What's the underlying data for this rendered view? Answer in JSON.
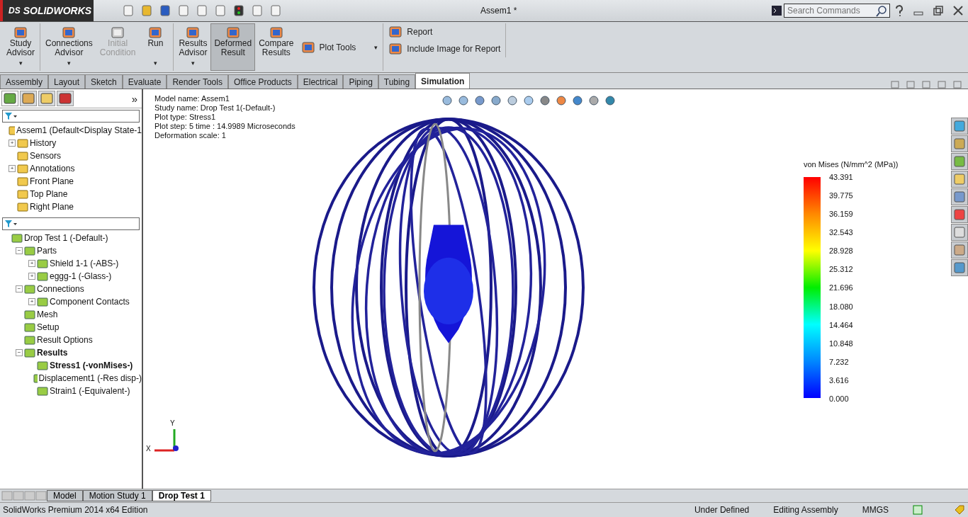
{
  "window": {
    "title": "Assem1 *",
    "logo_mark": "DS",
    "logo": "SOLIDWORKS"
  },
  "search": {
    "placeholder": "Search Commands"
  },
  "ribbon": {
    "groups": [
      {
        "buttons": [
          {
            "kind": "large",
            "lines": [
              "Study",
              "Advisor"
            ],
            "disabled": false,
            "selected": false,
            "caret": "▾"
          }
        ]
      },
      {
        "buttons": [
          {
            "kind": "large",
            "lines": [
              "Connections",
              "Advisor"
            ],
            "disabled": false,
            "selected": false,
            "caret": "▾"
          },
          {
            "kind": "large",
            "lines": [
              "Initial",
              "Condition"
            ],
            "disabled": true,
            "selected": false
          },
          {
            "kind": "large",
            "lines": [
              "Run"
            ],
            "disabled": false,
            "selected": false,
            "caret": "▾"
          }
        ]
      },
      {
        "buttons": [
          {
            "kind": "large",
            "lines": [
              "Results",
              "Advisor"
            ],
            "disabled": false,
            "selected": false,
            "caret": "▾"
          },
          {
            "kind": "large",
            "lines": [
              "Deformed",
              "Result"
            ],
            "disabled": false,
            "selected": true
          },
          {
            "kind": "large",
            "lines": [
              "Compare",
              "Results"
            ],
            "disabled": false,
            "selected": false
          },
          {
            "kind": "small",
            "lines": [
              "Plot Tools"
            ],
            "disabled": false,
            "selected": false,
            "caret": "▾"
          }
        ]
      },
      {
        "buttons": [
          {
            "kind": "small",
            "lines": [
              "Report"
            ],
            "disabled": false,
            "selected": false
          },
          {
            "kind": "small",
            "lines": [
              "Include Image for Report"
            ],
            "disabled": false,
            "selected": false
          }
        ]
      }
    ]
  },
  "tabs": [
    {
      "label": "Assembly",
      "selected": false
    },
    {
      "label": "Layout",
      "selected": false
    },
    {
      "label": "Sketch",
      "selected": false
    },
    {
      "label": "Evaluate",
      "selected": false
    },
    {
      "label": "Render Tools",
      "selected": false
    },
    {
      "label": "Office Products",
      "selected": false
    },
    {
      "label": "Electrical",
      "selected": false
    },
    {
      "label": "Piping",
      "selected": false
    },
    {
      "label": "Tubing",
      "selected": false
    },
    {
      "label": "Simulation",
      "selected": true
    }
  ],
  "feature_tree": {
    "expand_glyph": "»",
    "items": [
      {
        "label": "Assem1  (Default<Display State-1",
        "active": false,
        "children": [
          {
            "label": "History",
            "toggle": "+",
            "active": false
          },
          {
            "label": "Sensors",
            "active": false
          },
          {
            "label": "Annotations",
            "toggle": "+",
            "active": false
          },
          {
            "label": "Front Plane",
            "active": false
          },
          {
            "label": "Top Plane",
            "active": false
          },
          {
            "label": "Right Plane",
            "active": false
          }
        ]
      }
    ]
  },
  "study_tree": {
    "items": [
      {
        "label": "Drop Test 1 (-Default-)",
        "active": false,
        "children": [
          {
            "label": "Parts",
            "toggle": "−",
            "active": false,
            "children": [
              {
                "label": "Shield 1-1 (-ABS-)",
                "toggle": "+",
                "active": false
              },
              {
                "label": "eggg-1 (-Glass-)",
                "toggle": "+",
                "active": false
              }
            ]
          },
          {
            "label": "Connections",
            "toggle": "−",
            "active": false,
            "children": [
              {
                "label": "Component Contacts",
                "toggle": "+",
                "active": false
              }
            ]
          },
          {
            "label": "Mesh",
            "active": false
          },
          {
            "label": "Setup",
            "active": false
          },
          {
            "label": "Result Options",
            "active": false
          },
          {
            "label": "Results",
            "toggle": "−",
            "active": true,
            "children": [
              {
                "label": "Stress1 (-vonMises-)",
                "active": true
              },
              {
                "label": "Displacement1 (-Res disp-)",
                "active": false
              },
              {
                "label": "Strain1 (-Equivalent-)",
                "active": false
              }
            ]
          }
        ]
      }
    ]
  },
  "plot_info": [
    "Model name: Assem1",
    "Study name: Drop Test 1(-Default-)",
    "Plot type:  Stress1",
    "Plot step: 5   time : 14.9989 Microseconds",
    "Deformation scale: 1"
  ],
  "legend": {
    "title": "von Mises (N/mm^2 (MPa))",
    "values": [
      "43.391",
      "39.775",
      "36.159",
      "32.543",
      "28.928",
      "25.312",
      "21.696",
      "18.080",
      "14.464",
      "10.848",
      "7.232",
      "3.616",
      "0.000"
    ]
  },
  "triad": {
    "x": "X",
    "y": "Y"
  },
  "bottom_tabs": [
    {
      "label": "Model",
      "selected": false
    },
    {
      "label": "Motion Study 1",
      "selected": false
    },
    {
      "label": "Drop Test 1",
      "selected": true
    }
  ],
  "status_bar": {
    "edition": "SolidWorks Premium 2014 x64 Edition",
    "state": "Under Defined",
    "mode": "Editing Assembly",
    "units": "MMGS"
  }
}
